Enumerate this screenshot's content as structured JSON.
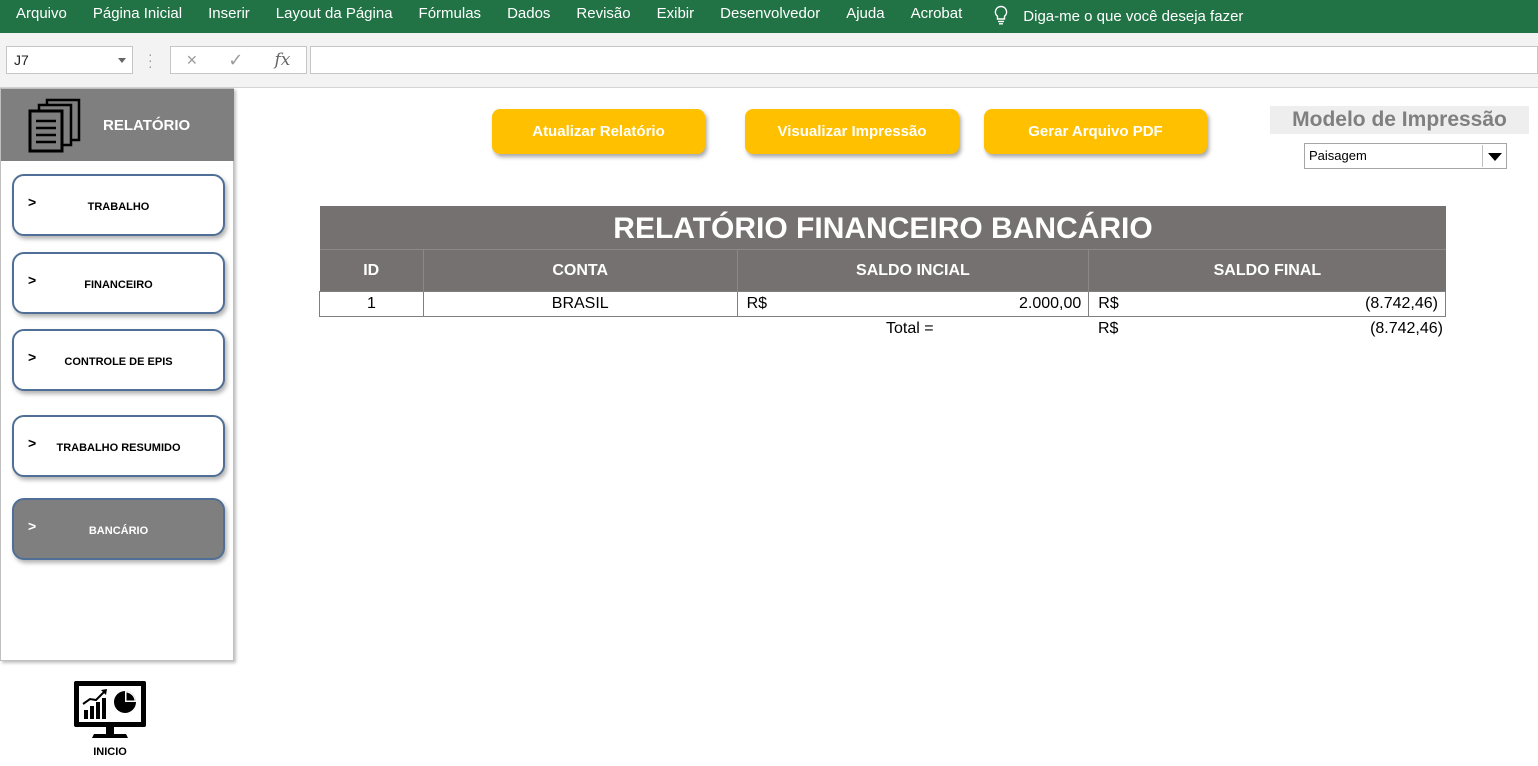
{
  "ribbon": {
    "tabs": [
      "Arquivo",
      "Página Inicial",
      "Inserir",
      "Layout da Página",
      "Fórmulas",
      "Dados",
      "Revisão",
      "Exibir",
      "Desenvolvedor",
      "Ajuda",
      "Acrobat"
    ],
    "tell_me": "Diga-me o que você deseja fazer",
    "tell_me_icon": "lightbulb-icon",
    "color": "#217346"
  },
  "formula_bar": {
    "name_box": "J7",
    "cancel_icon": "×",
    "enter_icon": "✓",
    "fx_label": "fx",
    "formula": ""
  },
  "sidebar": {
    "title": "RELATÓRIO",
    "header_icon": "documents-icon",
    "items": [
      {
        "chevron": ">",
        "label": "TRABALHO"
      },
      {
        "chevron": ">",
        "label": "FINANCEIRO"
      },
      {
        "chevron": ">",
        "label": "CONTROLE DE EPIS"
      },
      {
        "chevron": ">",
        "label": "TRABALHO RESUMIDO"
      },
      {
        "chevron": ">",
        "label": "BANCÁRIO",
        "active": true
      }
    ]
  },
  "inicio": {
    "label": "INICIO",
    "icon": "dashboard-monitor-icon"
  },
  "actions": {
    "update": "Atualizar Relatório",
    "preview": "Visualizar Impressão",
    "pdf": "Gerar Arquivo PDF",
    "color": "#ffc000"
  },
  "print_model": {
    "title": "Modelo de Impressão",
    "selected": "Paisagem"
  },
  "report": {
    "title": "RELATÓRIO FINANCEIRO BANCÁRIO",
    "headers": {
      "id": "ID",
      "conta": "CONTA",
      "saldo_inicial": "SALDO INCIAL",
      "saldo_final": "SALDO FINAL"
    },
    "rows": [
      {
        "id": "1",
        "conta": "BRASIL",
        "saldo_inicial_cur": "R$",
        "saldo_inicial": "2.000,00",
        "saldo_final_cur": "R$",
        "saldo_final": "(8.742,46)"
      }
    ],
    "total_label": "Total =",
    "total_cur": "R$",
    "total_value": "(8.742,46)",
    "header_color": "#767171"
  }
}
